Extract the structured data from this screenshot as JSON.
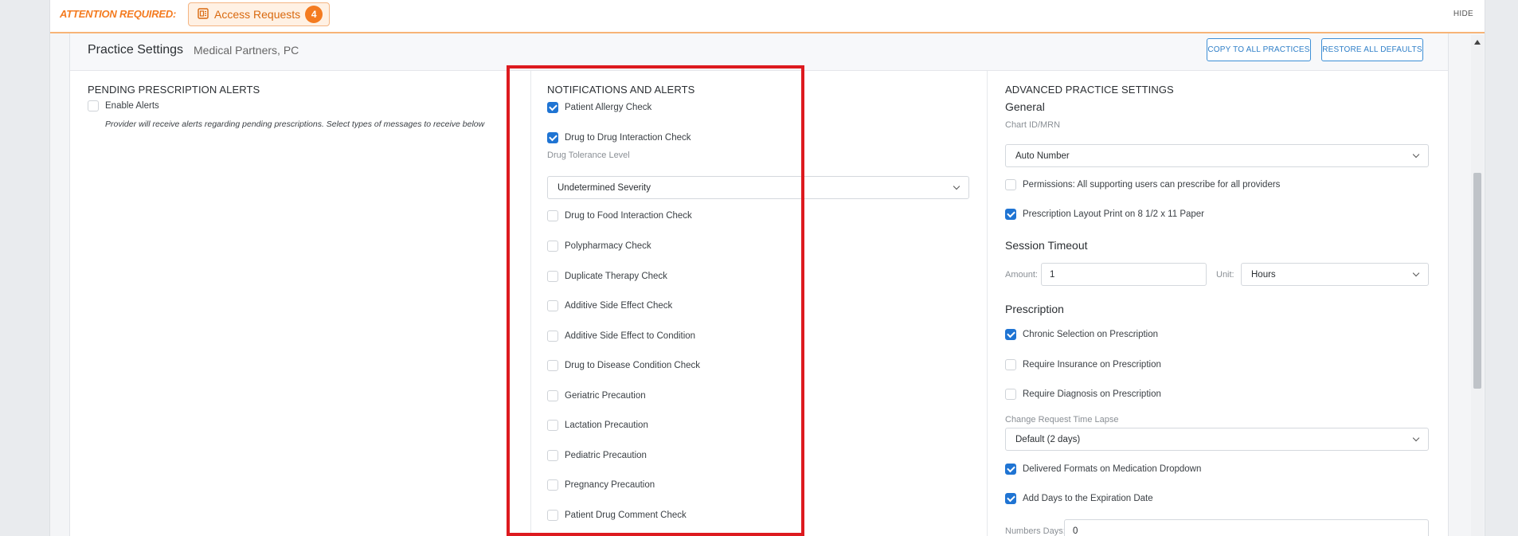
{
  "attention": {
    "label": "ATTENTION REQUIRED:",
    "access_requests_label": "Access Requests",
    "access_requests_count": "4",
    "hide_label": "HIDE"
  },
  "header": {
    "title": "Practice Settings",
    "practice_name": "Medical Partners, PC",
    "copy_button": "COPY TO ALL PRACTICES",
    "restore_button": "RESTORE ALL DEFAULTS"
  },
  "pending": {
    "title": "PENDING PRESCRIPTION ALERTS",
    "enable_label": "Enable Alerts",
    "enable_checked": false,
    "helper": "Provider will receive alerts regarding pending prescriptions. Select types of messages to receive below"
  },
  "notifications": {
    "title": "NOTIFICATIONS AND ALERTS",
    "items": [
      {
        "label": "Patient Allergy Check",
        "checked": true
      },
      {
        "label": "Drug to Drug Interaction Check",
        "checked": true
      },
      {
        "label": "Drug to Food Interaction Check",
        "checked": false
      },
      {
        "label": "Polypharmacy Check",
        "checked": false
      },
      {
        "label": "Duplicate Therapy Check",
        "checked": false
      },
      {
        "label": "Additive Side Effect Check",
        "checked": false
      },
      {
        "label": "Additive Side Effect to Condition",
        "checked": false
      },
      {
        "label": "Drug to Disease Condition Check",
        "checked": false
      },
      {
        "label": "Geriatric Precaution",
        "checked": false
      },
      {
        "label": "Lactation Precaution",
        "checked": false
      },
      {
        "label": "Pediatric Precaution",
        "checked": false
      },
      {
        "label": "Pregnancy Precaution",
        "checked": false
      },
      {
        "label": "Patient Drug Comment Check",
        "checked": false
      }
    ],
    "tolerance_label": "Drug Tolerance Level",
    "tolerance_value": "Undetermined Severity"
  },
  "advanced": {
    "title": "ADVANCED PRACTICE SETTINGS",
    "general_title": "General",
    "chart_label": "Chart ID/MRN",
    "chart_value": "Auto Number",
    "permissions_label": "Permissions: All supporting users can prescribe for all providers",
    "permissions_checked": false,
    "layout_label": "Prescription Layout Print on 8 1/2 x 11 Paper",
    "layout_checked": true,
    "session_title": "Session Timeout",
    "amount_label": "Amount:",
    "amount_value": "1",
    "unit_label": "Unit:",
    "unit_value": "Hours",
    "prescription_title": "Prescription",
    "chronic_label": "Chronic Selection on Prescription",
    "chronic_checked": true,
    "insurance_label": "Require Insurance on Prescription",
    "insurance_checked": false,
    "diagnosis_label": "Require Diagnosis on Prescription",
    "diagnosis_checked": false,
    "change_label": "Change Request Time Lapse",
    "change_value": "Default (2 days)",
    "delivered_label": "Delivered Formats on Medication Dropdown",
    "delivered_checked": true,
    "add_days_label": "Add Days to the Expiration Date",
    "add_days_checked": true,
    "numbers_days_label": "Numbers Days:",
    "numbers_days_value": "0"
  }
}
